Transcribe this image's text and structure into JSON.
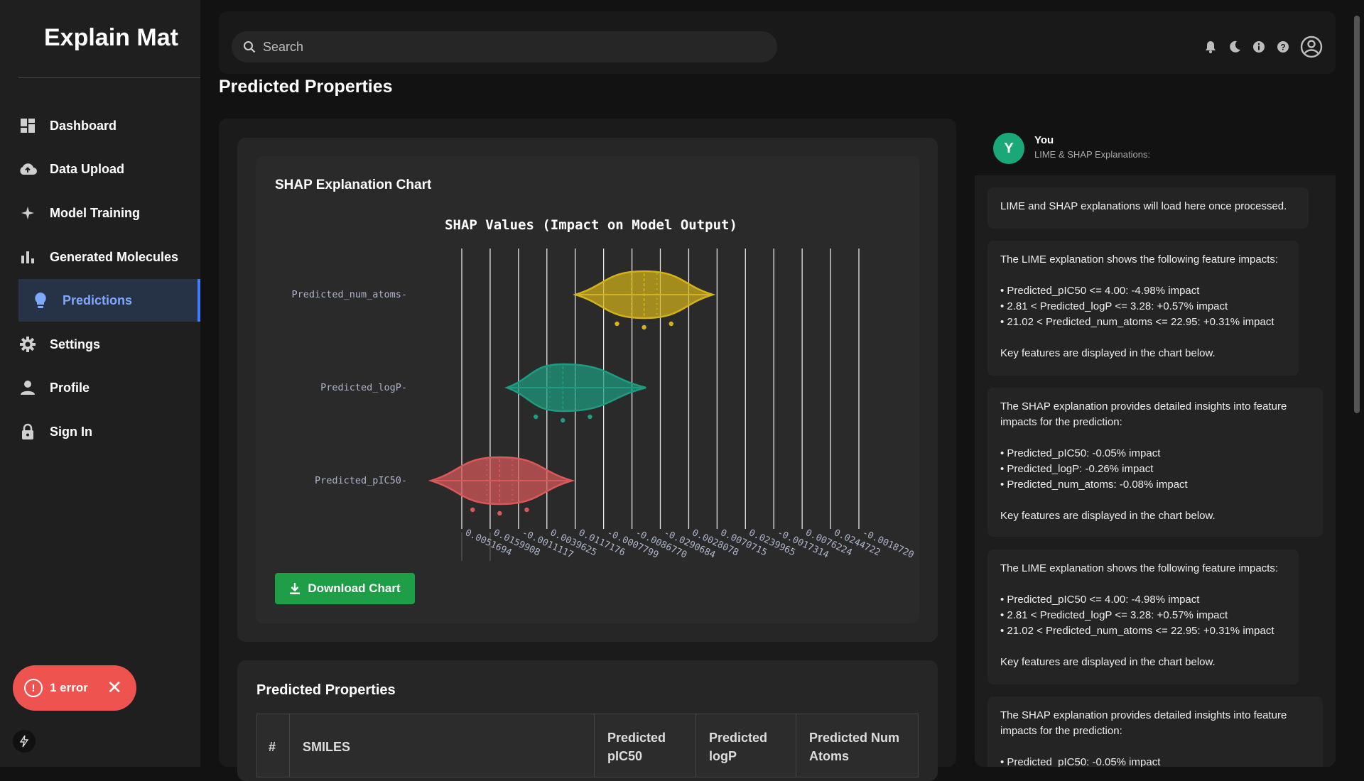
{
  "app": {
    "title": "Explain Mat"
  },
  "sidebar": {
    "items": [
      {
        "label": "Dashboard",
        "icon": "dashboard-icon"
      },
      {
        "label": "Data Upload",
        "icon": "cloud-upload-icon"
      },
      {
        "label": "Model Training",
        "icon": "sparkle-icon"
      },
      {
        "label": "Generated Molecules",
        "icon": "bar-chart-icon"
      },
      {
        "label": "Predictions",
        "icon": "lightbulb-icon",
        "active": true
      },
      {
        "label": "Settings",
        "icon": "gear-icon"
      },
      {
        "label": "Profile",
        "icon": "person-icon"
      },
      {
        "label": "Sign In",
        "icon": "lock-icon"
      }
    ]
  },
  "search": {
    "placeholder": "Search"
  },
  "header": {
    "page_title": "Predicted Properties"
  },
  "chart_card": {
    "title": "SHAP Explanation Chart",
    "download_label": "Download Chart"
  },
  "chart_data": {
    "type": "violin",
    "title": "SHAP Values (Impact on Model Output)",
    "categories": [
      "Predicted_num_atoms",
      "Predicted_logP",
      "Predicted_pIC50"
    ],
    "x_tick_labels": [
      "0.0051694",
      "0.0159908",
      "-0.0011117",
      "0.0039625",
      "0.0117176",
      "-0.0007799",
      "-0.0086770",
      "-0.0290684",
      "0.0028078",
      "0.0070715",
      "0.0239965",
      "-0.0017314",
      "0.0076224",
      "0.0244722",
      "-0.0018720"
    ],
    "series": [
      {
        "name": "Predicted_num_atoms",
        "color": "#d4b21a",
        "min": -0.0033,
        "max": 0.0043,
        "median": 0.0005,
        "points": [
          -0.001,
          0.0005,
          0.002
        ]
      },
      {
        "name": "Predicted_logP",
        "color": "#1e9c80",
        "min": -0.0071,
        "max": 0.0006,
        "median": -0.004,
        "points": [
          -0.0055,
          -0.004,
          -0.0025
        ]
      },
      {
        "name": "Predicted_pIC50",
        "color": "#d9595a",
        "min": -0.0113,
        "max": -0.0035,
        "median": -0.0075,
        "points": [
          -0.009,
          -0.0075,
          -0.006
        ]
      }
    ],
    "xlim": [
      -0.0096,
      0.0124
    ],
    "grid": true
  },
  "table": {
    "title": "Predicted Properties",
    "columns": [
      "#",
      "SMILES",
      "Predicted pIC50",
      "Predicted logP",
      "Predicted Num Atoms"
    ]
  },
  "chat": {
    "user_name": "You",
    "avatar_letter": "Y",
    "subtitle": "LIME & SHAP Explanations:",
    "messages": [
      "LIME and SHAP explanations will load here once processed.",
      "The LIME explanation shows the following feature impacts:\n\n• Predicted_pIC50 <= 4.00: -4.98% impact\n• 2.81 < Predicted_logP <= 3.28: +0.57% impact\n• 21.02 < Predicted_num_atoms <= 22.95: +0.31% impact\n\nKey features are displayed in the chart below.",
      "The SHAP explanation provides detailed insights into feature impacts for the prediction:\n\n• Predicted_pIC50: -0.05% impact\n• Predicted_logP: -0.26% impact\n• Predicted_num_atoms: -0.08% impact\n\nKey features are displayed in the chart below.",
      "The LIME explanation shows the following feature impacts:\n\n• Predicted_pIC50 <= 4.00: -4.98% impact\n• 2.81 < Predicted_logP <= 3.28: +0.57% impact\n• 21.02 < Predicted_num_atoms <= 22.95: +0.31% impact\n\nKey features are displayed in the chart below.",
      "The SHAP explanation provides detailed insights into feature impacts for the prediction:\n\n• Predicted_pIC50: -0.05% impact"
    ]
  },
  "toast": {
    "error_label": "1 error"
  }
}
